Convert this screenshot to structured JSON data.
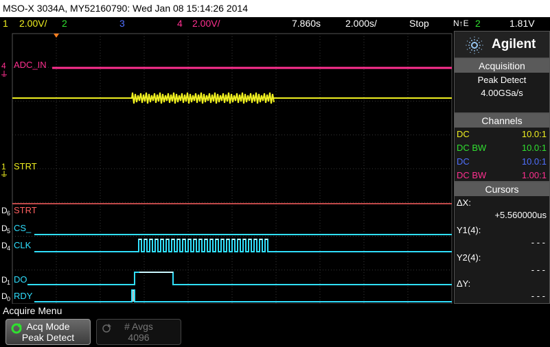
{
  "title": "MSO-X 3034A, MY52160790: Wed Jan 08 15:14:26 2014",
  "status": {
    "ch1_num": "1",
    "ch1_scale": "2.00V/",
    "ch2_num": "2",
    "ch3_num": "3",
    "ch4_num": "4",
    "ch4_scale": "2.00V/",
    "delay": "7.860s",
    "timebase": "2.000s/",
    "run_state": "Stop",
    "trigger_mode": "N↑E",
    "trigger_ch": "2",
    "trigger_level": "1.81V"
  },
  "waveform_labels": {
    "adc_in": "ADC_IN",
    "strt": "STRT",
    "ch4_marker": "4",
    "ch1_marker": "1"
  },
  "digital": [
    {
      "id": "D",
      "sub": "6",
      "label": "STRT"
    },
    {
      "id": "D",
      "sub": "5",
      "label": "CS_"
    },
    {
      "id": "D",
      "sub": "4",
      "label": "CLK"
    },
    {
      "id": "D",
      "sub": "1",
      "label": "DO"
    },
    {
      "id": "D",
      "sub": "0",
      "label": "RDY"
    }
  ],
  "panel": {
    "brand": "Agilent",
    "acquisition": {
      "header": "Acquisition",
      "mode": "Peak Detect",
      "rate": "4.00GSa/s"
    },
    "channels": {
      "header": "Channels",
      "rows": [
        {
          "coupling": "DC",
          "probe": "10.0:1",
          "color": "#f0f020"
        },
        {
          "coupling": "DC BW",
          "probe": "10.0:1",
          "color": "#30e030"
        },
        {
          "coupling": "DC",
          "probe": "10.0:1",
          "color": "#5070ff"
        },
        {
          "coupling": "DC BW",
          "probe": "1.00:1",
          "color": "#ff3090"
        }
      ]
    },
    "cursors": {
      "header": "Cursors",
      "dx_label": "ΔX:",
      "dx_value": "+5.560000us",
      "y1_label": "Y1(4):",
      "y1_value": "- - -",
      "y2_label": "Y2(4):",
      "y2_value": "- - -",
      "dy_label": "ΔY:",
      "dy_value": "- - -"
    }
  },
  "menu": {
    "title": "Acquire Menu",
    "acq_mode_label": "Acq Mode",
    "acq_mode_value": "Peak Detect",
    "avgs_label": "# Avgs",
    "avgs_value": "4096"
  },
  "colors": {
    "ch1": "#f0f020",
    "ch2": "#30e030",
    "ch3": "#5070ff",
    "ch4": "#ff3090",
    "digital": "#30e0ff",
    "digital_high": "#ffffff",
    "strt_digital": "#ff6060"
  }
}
